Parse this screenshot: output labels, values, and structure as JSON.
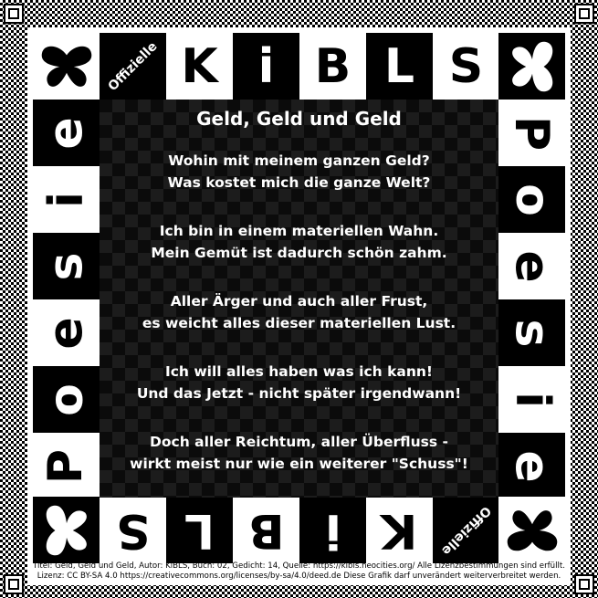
{
  "header": {
    "badge": "Offizielle",
    "letters": [
      "K",
      "i",
      "B",
      "L",
      "S"
    ]
  },
  "side_word": [
    "P",
    "o",
    "e",
    "s",
    "i",
    "e"
  ],
  "poem": {
    "title": "Geld, Geld und Geld",
    "stanzas": [
      [
        "Wohin mit meinem ganzen Geld?",
        "Was kostet mich die ganze Welt?"
      ],
      [
        "Ich bin in einem materiellen Wahn.",
        "Mein Gemüt ist dadurch schön zahm."
      ],
      [
        "Aller Ärger und auch aller Frust,",
        "es weicht alles dieser materiellen Lust."
      ],
      [
        "Ich will alles haben was ich kann!",
        "Und das Jetzt - nicht später irgendwann!"
      ],
      [
        "Doch aller Reichtum, aller Überfluss -",
        "wirkt meist nur wie ein weiterer \"Schuss\"!"
      ]
    ]
  },
  "footer": {
    "line1": "Titel: Geld, Geld und Geld, Autor: KiBLS, Buch: 02, Gedicht: 14, Quelle: https://kibls.neocities.org/ Alle Lizenzbestimmungen sind erfüllt.",
    "line2": "Lizenz: CC BY-SA 4.0 https://creativecommons.org/licenses/by-sa/4.0/deed.de Diese Grafik darf unverändert weiterverbreitet werden."
  },
  "icons": [
    "butterfly-icon"
  ]
}
